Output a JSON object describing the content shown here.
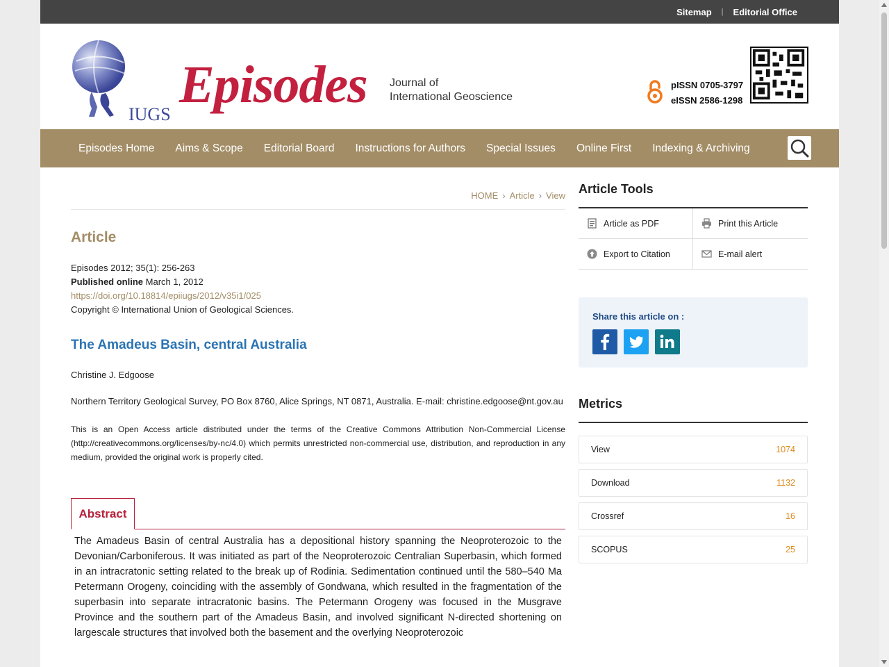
{
  "topbar": {
    "sitemap": "Sitemap",
    "separator": "|",
    "editorial_office": "Editorial Office"
  },
  "header": {
    "logo_iugs": "IUGS",
    "logo_title": "Episodes",
    "logo_subtitle_1": "Journal of",
    "logo_subtitle_2": "International Geoscience",
    "pissn": "pISSN 0705-3797",
    "eissn": "eISSN 2586-1298"
  },
  "nav": {
    "items": [
      {
        "label": "Episodes Home"
      },
      {
        "label": "Aims & Scope"
      },
      {
        "label": "Editorial Board"
      },
      {
        "label": "Instructions for Authors"
      },
      {
        "label": "Special Issues"
      },
      {
        "label": "Online First"
      },
      {
        "label": "Indexing & Archiving"
      }
    ]
  },
  "breadcrumb": {
    "home": "HOME",
    "article": "Article",
    "view": "View"
  },
  "article": {
    "section": "Article",
    "citation": "Episodes 2012; 35(1): 256-263",
    "published_label": "Published online",
    "published_date": "March 1, 2012",
    "doi": "https://doi.org/10.18814/epiiugs/2012/v35i1/025",
    "copyright": "Copyright © International Union of Geological Sciences.",
    "title": "The Amadeus Basin, central Australia",
    "author": "Christine J. Edgoose",
    "affiliation": "Northern Territory Geological Survey, PO Box 8760, Alice Springs, NT 0871, Australia. E-mail: christine.edgoose@nt.gov.au",
    "license": "This is an Open Access article distributed under the terms of the Creative Commons Attribution Non-Commercial License (http://creativecommons.org/licenses/by-nc/4.0) which permits unrestricted non-commercial use, distribution, and reproduction in any medium, provided the original work is properly cited.",
    "abstract_tab": "Abstract",
    "abstract": "The Amadeus Basin of central Australia has a depositional history spanning the Neoproterozoic to the Devonian/Carboniferous. It was initiated as part of the Neoproterozoic Centralian Superbasin, which formed in an intracratonic setting related to the break up of Rodinia. Sedimentation continued until the 580–540 Ma Petermann Orogeny, coinciding with the assembly of Gondwana, which resulted in the fragmentation of the superbasin into separate intracratonic basins. The Petermann Orogeny was focused in the Musgrave Province and the southern part of the Amadeus Basin, and involved significant N-directed shortening on largescale structures that involved both the basement and the overlying Neoproterozoic"
  },
  "tools": {
    "heading": "Article Tools",
    "items": [
      {
        "label": "Article as PDF",
        "icon": "pdf-icon"
      },
      {
        "label": "Print this Article",
        "icon": "printer-icon"
      },
      {
        "label": "Export to Citation",
        "icon": "export-icon"
      },
      {
        "label": "E-mail alert",
        "icon": "envelope-icon"
      }
    ]
  },
  "share": {
    "label": "Share this article on :",
    "icons": [
      "facebook-icon",
      "twitter-icon",
      "linkedin-icon"
    ],
    "colors": {
      "facebook": "#1f5aa6",
      "twitter": "#1da1f2",
      "linkedin": "#0e7a8a"
    }
  },
  "metrics": {
    "heading": "Metrics",
    "items": [
      {
        "label": "View",
        "value": "1074"
      },
      {
        "label": "Download",
        "value": "1132"
      },
      {
        "label": "Crossref",
        "value": "16"
      },
      {
        "label": "SCOPUS",
        "value": "25"
      }
    ]
  },
  "colors": {
    "nav": "#a38d66",
    "brand_red": "#c3203f",
    "accent_gold": "#a38d66",
    "title_blue": "#2a73b3",
    "metric_orange": "#e08a1c"
  }
}
